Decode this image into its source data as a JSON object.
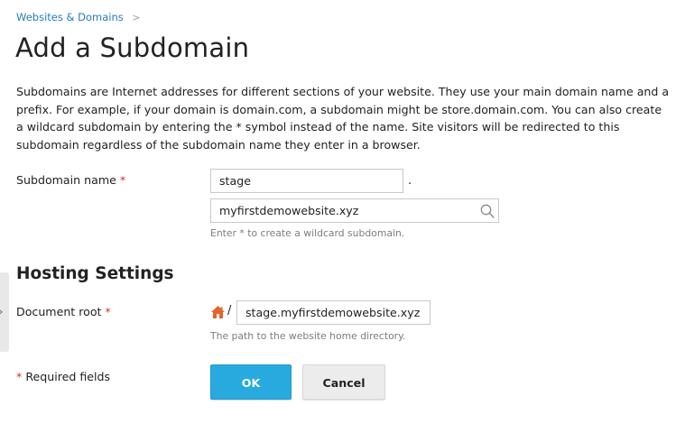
{
  "breadcrumb": {
    "link": "Websites & Domains",
    "separator": ">"
  },
  "page_title": "Add a Subdomain",
  "description": "Subdomains are Internet addresses for different sections of your website. They use your main domain name and a prefix. For example, if your domain is domain.com, a subdomain might be store.domain.com. You can also create a wildcard subdomain by entering the * symbol instead of the name. Site visitors will be redirected to this subdomain regardless of the subdomain name they enter in a browser.",
  "subdomain": {
    "label": "Subdomain name",
    "required_mark": "*",
    "name_value": "stage",
    "separator": ".",
    "domain_value": "myfirstdemowebsite.xyz",
    "hint": "Enter * to create a wildcard subdomain.",
    "domain_icon": "search-icon"
  },
  "hosting": {
    "title": "Hosting Settings",
    "docroot_label": "Document root",
    "required_mark": "*",
    "home_icon": "home-icon",
    "slash": "/",
    "docroot_value": "stage.myfirstdemowebsite.xyz",
    "hint": "The path to the website home directory."
  },
  "footer": {
    "required_mark": "*",
    "required_text": "Required fields",
    "ok_label": "OK",
    "cancel_label": "Cancel"
  },
  "sidebar_handle_icon": "chevron-right-icon",
  "colors": {
    "link": "#2a7ab8",
    "required": "#d0312d",
    "primary_button": "#28aade",
    "home_icon": "#e8632a"
  }
}
